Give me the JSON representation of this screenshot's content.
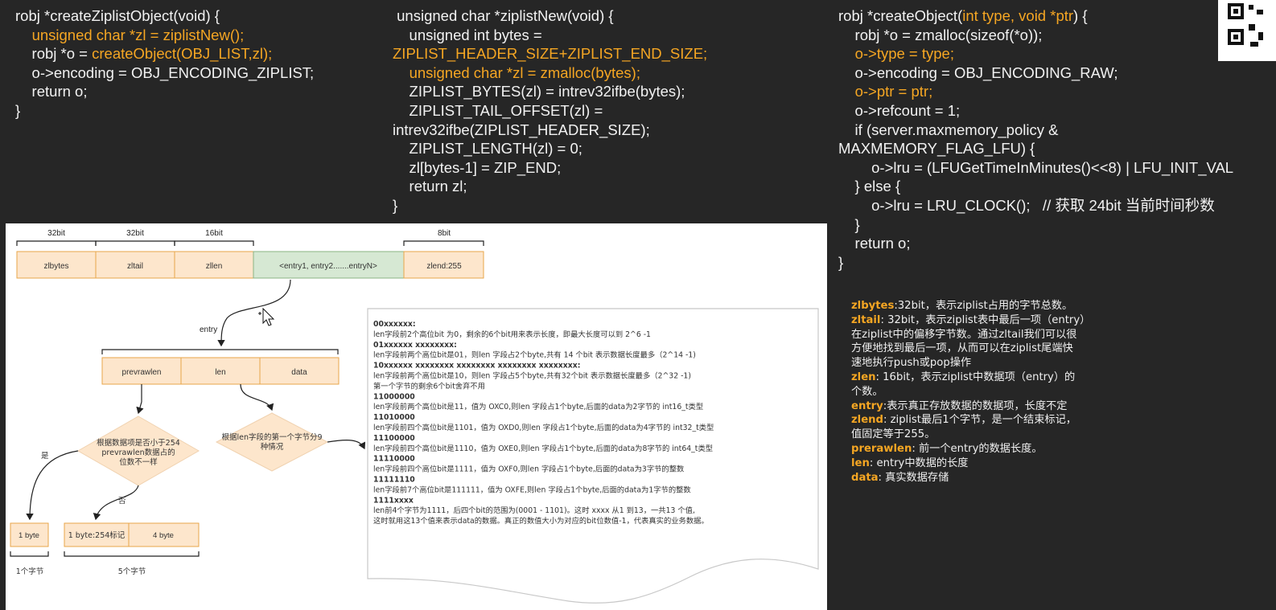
{
  "code1": [
    {
      "segs": [
        {
          "t": "robj *createZiplistObject(void) {"
        }
      ]
    },
    {
      "segs": [
        {
          "t": "    "
        },
        {
          "t": "unsigned char *zl = ziplistNew();",
          "hl": true
        }
      ]
    },
    {
      "segs": [
        {
          "t": "    robj *o = "
        },
        {
          "t": "createObject(OBJ_LIST,zl);",
          "hl": true
        }
      ]
    },
    {
      "segs": [
        {
          "t": "    o->encoding = OBJ_ENCODING_ZIPLIST;"
        }
      ]
    },
    {
      "segs": [
        {
          "t": "    return o;"
        }
      ]
    },
    {
      "segs": [
        {
          "t": "}"
        }
      ]
    }
  ],
  "code2": [
    {
      "segs": [
        {
          "t": " unsigned char *ziplistNew(void) {"
        }
      ]
    },
    {
      "segs": [
        {
          "t": "    unsigned int bytes ="
        }
      ]
    },
    {
      "segs": [
        {
          "t": "ZIPLIST_HEADER_SIZE+ZIPLIST_END_SIZE;",
          "hl": true
        }
      ]
    },
    {
      "segs": [
        {
          "t": "    "
        },
        {
          "t": "unsigned char *zl = zmalloc(bytes);",
          "hl": true
        }
      ]
    },
    {
      "segs": [
        {
          "t": "    ZIPLIST_BYTES(zl) = intrev32ifbe(bytes);"
        }
      ]
    },
    {
      "segs": [
        {
          "t": "    ZIPLIST_TAIL_OFFSET(zl) ="
        }
      ]
    },
    {
      "segs": [
        {
          "t": "intrev32ifbe(ZIPLIST_HEADER_SIZE);"
        }
      ]
    },
    {
      "segs": [
        {
          "t": "    ZIPLIST_LENGTH(zl) = 0;"
        }
      ]
    },
    {
      "segs": [
        {
          "t": "    zl[bytes-1] = ZIP_END;"
        }
      ]
    },
    {
      "segs": [
        {
          "t": "    return zl;"
        }
      ]
    },
    {
      "segs": [
        {
          "t": "}"
        }
      ]
    }
  ],
  "code3": [
    {
      "segs": [
        {
          "t": "robj *createObject("
        },
        {
          "t": "int type, void *ptr",
          "hl": true
        },
        {
          "t": ") {"
        }
      ]
    },
    {
      "segs": [
        {
          "t": "    robj *o = zmalloc(sizeof(*o));"
        }
      ]
    },
    {
      "segs": [
        {
          "t": "    "
        },
        {
          "t": "o->type = type;",
          "hl": true
        }
      ]
    },
    {
      "segs": [
        {
          "t": "    o->encoding = OBJ_ENCODING_RAW;"
        }
      ]
    },
    {
      "segs": [
        {
          "t": "    "
        },
        {
          "t": "o->ptr = ptr;",
          "hl": true
        }
      ]
    },
    {
      "segs": [
        {
          "t": "    o->refcount = 1;"
        }
      ]
    },
    {
      "segs": [
        {
          "t": "    if (server.maxmemory_policy &"
        }
      ]
    },
    {
      "segs": [
        {
          "t": "MAXMEMORY_FLAG_LFU) {"
        }
      ]
    },
    {
      "segs": [
        {
          "t": "        o->lru = (LFUGetTimeInMinutes()<<8) | LFU_INIT_VAL"
        }
      ]
    },
    {
      "segs": [
        {
          "t": "    } else {"
        }
      ]
    },
    {
      "segs": [
        {
          "t": "        o->lru = LRU_CLOCK();   // 获取 24bit 当前时间秒数"
        }
      ]
    },
    {
      "segs": [
        {
          "t": "    }"
        }
      ]
    },
    {
      "segs": [
        {
          "t": "    return o;"
        }
      ]
    },
    {
      "segs": [
        {
          "t": "}"
        }
      ]
    }
  ],
  "diagram": {
    "header_fields": [
      {
        "label": "zlbytes",
        "bits": "32bit"
      },
      {
        "label": "zltail",
        "bits": "32bit"
      },
      {
        "label": "zllen",
        "bits": "16bit"
      },
      {
        "label": "<entry1, entry2.......entryN>",
        "bits": ""
      },
      {
        "label": "zlend:255",
        "bits": "8bit"
      }
    ],
    "entry_label": "entry",
    "entry_fields": [
      "prevrawlen",
      "len",
      "data"
    ],
    "decision1": [
      "根据数据项是否小于254",
      "prevrawlen数据占的",
      "位数不一样"
    ],
    "decision2": [
      "根据len字段的第一个字节分9",
      "种情况"
    ],
    "yes_label": "是",
    "no_label": "否",
    "box_1byte": "1 byte",
    "box_254": "1 byte:254标记",
    "box_4byte": "4 byte",
    "caption_1": "1个字节",
    "caption_5": "5个字节",
    "note_lines": [
      {
        "t": "00xxxxxx:",
        "b": true
      },
      {
        "t": "len字段前2个高位bit 为0，剩余的6个bit用来表示长度，即最大长度可以到 2^6 -1"
      },
      {
        "t": "01xxxxxx xxxxxxxx:",
        "b": true
      },
      {
        "t": "len字段前两个高位bit是01，则len 字段占2个byte,共有 14 个bit 表示数据长度最多（2^14 -1)"
      },
      {
        "t": "10xxxxxx xxxxxxxx xxxxxxxx xxxxxxxx xxxxxxxx:",
        "b": true
      },
      {
        "t": "len字段前两个高位bit是10，则len 字段占5个byte,共有32个bit 表示数据长度最多（2^32 -1)"
      },
      {
        "t": "第一个字节的剩余6个bit舍弃不用"
      },
      {
        "t": "11000000",
        "b": true
      },
      {
        "t": "len字段前两个高位bit是11，值为 OXC0,则len 字段占1个byte,后面的data为2字节的 int16_t类型"
      },
      {
        "t": "11010000",
        "b": true
      },
      {
        "t": "len字段前四个高位bit是1101，值为 OXD0,则len 字段占1个byte,后面的data为4字节的 int32_t类型"
      },
      {
        "t": "11100000",
        "b": true
      },
      {
        "t": "len字段前四个高位bit是1110，值为 OXE0,则len 字段占1个byte,后面的data为8字节的 int64_t类型"
      },
      {
        "t": "11110000",
        "b": true
      },
      {
        "t": "len字段前四个高位bit是1111，值为 OXF0,则len 字段占1个byte,后面的data为3字节的整数"
      },
      {
        "t": "11111110",
        "b": true
      },
      {
        "t": "len字段前7个高位bit是111111，值为 OXFE,则len 字段占1个byte,后面的data为1字节的整数"
      },
      {
        "t": "1111xxxx",
        "b": true
      },
      {
        "t": "len前4个字节为1111，后四个bit的范围为(0001 - 1101)。这时 xxxx 从1 到13，一共13 个值,"
      },
      {
        "t": "这时就用这13个值来表示data的数据。真正的数值大小为对应的bit位数值-1，代表真实的业务数据。"
      }
    ]
  },
  "notes": [
    {
      "k": "zlbytes",
      "v": ":32bit，表示ziplist占用的字节总数。"
    },
    {
      "k": "zltail",
      "v": ":    32bit，表示ziplist表中最后一项（entry）"
    },
    {
      "k": "",
      "v": "在ziplist中的偏移字节数。通过zltail我们可以很"
    },
    {
      "k": "",
      "v": "方便地找到最后一项，从而可以在ziplist尾端快"
    },
    {
      "k": "",
      "v": "速地执行push或pop操作"
    },
    {
      "k": "zlen",
      "v": ":    16bit，表示ziplist中数据项（entry）的"
    },
    {
      "k": "",
      "v": "个数。"
    },
    {
      "k": "entry",
      "v": ":表示真正存放数据的数据项，长度不定"
    },
    {
      "k": "zlend",
      "v": ": ziplist最后1个字节，是一个结束标记，"
    },
    {
      "k": "",
      "v": "值固定等于255。"
    },
    {
      "k": "prerawlen",
      "v": ": 前一个entry的数据长度。"
    },
    {
      "k": "len",
      "v": ": entry中数据的长度"
    },
    {
      "k": "data",
      "v": ": 真实数据存储"
    }
  ]
}
